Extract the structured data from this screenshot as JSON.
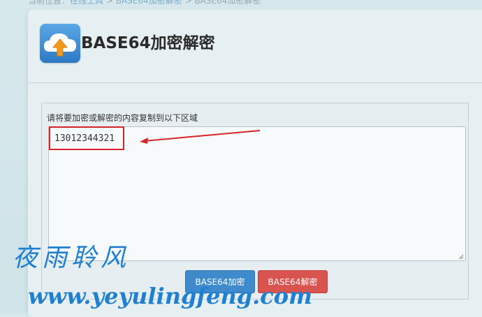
{
  "breadcrumb": {
    "prefix": "当前位置：",
    "link1": "在线工具",
    "sep1": " > ",
    "link2": "BASE64加密解密",
    "sep2": " > ",
    "current": "BASE64加密解密"
  },
  "header": {
    "title": "BASE64加密解密",
    "logo_icon": "cloud-upload-icon"
  },
  "form": {
    "label": "请将要加密或解密的内容复制到以下区域",
    "textarea_value": "13012344321"
  },
  "buttons": {
    "encrypt_label": "BASE64加密",
    "decrypt_label": "BASE64解密"
  },
  "watermark": {
    "cn": "夜雨聆风",
    "url": "www.yeyulingfeng.com"
  },
  "colors": {
    "encrypt_button": "#3e8acc",
    "decrypt_button": "#d9534f",
    "highlight": "#d6252a",
    "watermark": "#1f7fd0"
  }
}
